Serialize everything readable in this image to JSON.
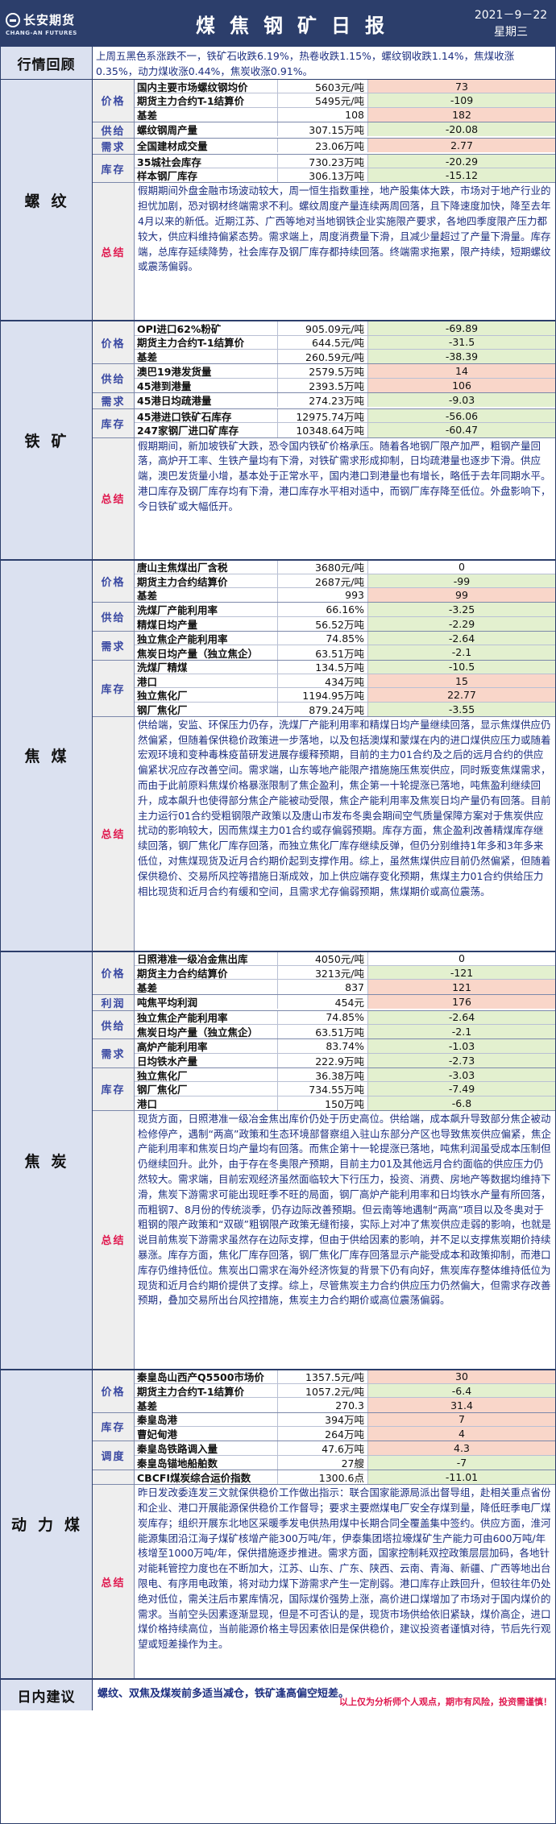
{
  "header": {
    "logo_cn": "长安期货",
    "logo_en": "CHANG-AN FUTURES",
    "title": "煤焦钢矿日报",
    "date": "2021－9－22",
    "weekday": "星期三"
  },
  "review": {
    "label": "行情回顾",
    "text": "上周五黑色系涨跌不一，铁矿石收跌6.19%，热卷收跌1.15%，螺纹钢收跌1.14%，焦煤收涨0.35%，动力煤收涨0.44%，焦炭收涨0.91%。"
  },
  "sections": [
    {
      "name": "螺纹",
      "groups": [
        {
          "label": "价格",
          "rows": [
            [
              "国内主要市场螺纹钢均价",
              "5603元/吨",
              "73",
              "up"
            ],
            [
              "期货主力合约T-1结算价",
              "5495元/吨",
              "-109",
              "dn"
            ],
            [
              "基差",
              "108",
              "182",
              "up"
            ]
          ]
        },
        {
          "label": "供给",
          "rows": [
            [
              "螺纹钢周产量",
              "307.15万吨",
              "-20.08",
              "dn"
            ]
          ]
        },
        {
          "label": "需求",
          "rows": [
            [
              "全国建材成交量",
              "23.06万吨",
              "2.77",
              "up"
            ]
          ]
        },
        {
          "label": "库存",
          "rows": [
            [
              "35城社会库存",
              "730.23万吨",
              "-20.29",
              "dn"
            ],
            [
              "样本钢厂库存",
              "306.13万吨",
              "-15.12",
              "dn"
            ]
          ]
        }
      ],
      "summary": "假期期间外盘金融市场波动较大，周一恒生指数重挫，地产股集体大跌，市场对于地产行业的担忧加剧，恐对钢材终端需求不利。螺纹周度产量连续两周回落，且下降速度加快，降至去年4月以来的新低。近期江苏、广西等地对当地钢铁企业实施限产要求，各地四季度限产压力都较大，供应料维持偏紧态势。需求端上，周度消费量下滑，且减少量超过了产量下滑量。库存端，总库存延续降势，社会库存及钢厂库存都持续回落。终端需求拖累，限产持续，短期螺纹或震荡偏弱。"
    },
    {
      "name": "铁矿",
      "groups": [
        {
          "label": "价格",
          "rows": [
            [
              "OPI进口62%粉矿",
              "905.09元/吨",
              "-69.89",
              "dn"
            ],
            [
              "期货主力合约T-1结算价",
              "644.5元/吨",
              "-31.5",
              "dn"
            ],
            [
              "基差",
              "260.59元/吨",
              "-38.39",
              "dn"
            ]
          ]
        },
        {
          "label": "供给",
          "rows": [
            [
              "澳巴19港发货量",
              "2579.5万吨",
              "14",
              "up"
            ],
            [
              "45港到港量",
              "2393.5万吨",
              "106",
              "up"
            ]
          ]
        },
        {
          "label": "需求",
          "rows": [
            [
              "45港日均疏港量",
              "274.23万吨",
              "-9.03",
              "dn"
            ]
          ]
        },
        {
          "label": "库存",
          "rows": [
            [
              "45港进口铁矿石库存",
              "12975.74万吨",
              "-56.06",
              "dn"
            ],
            [
              "247家钢厂进口矿库存",
              "10348.64万吨",
              "-60.47",
              "dn"
            ]
          ]
        }
      ],
      "summary": "假期期间，新加坡铁矿大跌，恐令国内铁矿价格承压。随着各地钢厂限产加严，粗钢产量回落，高炉开工率、生铁产量均有下滑，对铁矿需求形成抑制，日均疏港量也逐步下滑。供应端，澳巴发货量小增，基本处于正常水平，国内港口到港量也有增长，略低于去年同期水平。港口库存及钢厂库存均有下滑，港口库存水平相对适中，而钢厂库存降至低位。外盘影响下，今日铁矿或大幅低开。"
    },
    {
      "name": "焦煤",
      "groups": [
        {
          "label": "价格",
          "rows": [
            [
              "唐山主焦煤出厂含税",
              "3680元/吨",
              "0",
              "zero"
            ],
            [
              "期货主力合约结算价",
              "2687元/吨",
              "-99",
              "dn"
            ],
            [
              "基差",
              "993",
              "99",
              "up"
            ]
          ]
        },
        {
          "label": "供给",
          "rows": [
            [
              "洗煤厂产能利用率",
              "66.16%",
              "-3.25",
              "dn"
            ],
            [
              "精煤日均产量",
              "56.52万吨",
              "-2.29",
              "dn"
            ]
          ]
        },
        {
          "label": "需求",
          "rows": [
            [
              "独立焦企产能利用率",
              "74.85%",
              "-2.64",
              "dn"
            ],
            [
              "焦炭日均产量（独立焦企）",
              "63.51万吨",
              "-2.1",
              "dn"
            ]
          ]
        },
        {
          "label": "库存",
          "rows": [
            [
              "洗煤厂精煤",
              "134.5万吨",
              "-10.5",
              "dn"
            ],
            [
              "港口",
              "434万吨",
              "15",
              "up"
            ],
            [
              "独立焦化厂",
              "1194.95万吨",
              "22.77",
              "up"
            ],
            [
              "钢厂焦化厂",
              "879.24万吨",
              "-3.55",
              "dn"
            ]
          ]
        }
      ],
      "summary": "供给端，安监、环保压力仍存，洗煤厂产能利用率和精煤日均产量继续回落，显示焦煤供应仍然偏紧，但随着保供稳价政策进一步落地，以及包括澳煤和蒙煤在内的进口煤供应压力或随着宏观环境和变种毒株疫苗研发进展存缓释预期，目前的主力01合约及之后的远月合约的供应偏紧状况应存改善空间。需求端，山东等地产能限产措施施压焦炭供应，同时叛变焦煤需求，而由于此前原料焦煤价格暴涨限制了焦企盈利，焦企第一十轮提涨已落地，吨焦盈利继续回升，成本飙升也使得部分焦企产能被动受限，焦企产能利用率及焦炭日均产量仍有回落。目前主力运行01合约受粗钢限产政策以及唐山市发布冬奥会期间空气质量保障方案对于焦炭供应扰动的影响较大，因而焦煤主力01合约或存偏弱预期。库存方面，焦企盈利改善精煤库存继续回落，钢厂焦化厂库存回落，而独立焦化厂库存继续反弹，但仍分别维持1年多和3年多来低位，对焦煤现货及近月合约期价起到支撑作用。综上，虽然焦煤供应目前仍然偏紧，但随着保供稳价、交易所风控等措施日渐成效，加上供应端存变化预期，焦煤主力01合约供给压力相比现货和近月合约有缓和空间，且需求尤存偏弱预期，焦煤期价或高位震荡。"
    },
    {
      "name": "焦炭",
      "groups": [
        {
          "label": "价格",
          "rows": [
            [
              "日照港准一级冶金焦出库",
              "4050元/吨",
              "0",
              "zero"
            ],
            [
              "期货主力合约结算价",
              "3213元/吨",
              "-121",
              "dn"
            ],
            [
              "基差",
              "837",
              "121",
              "up"
            ]
          ]
        },
        {
          "label": "利润",
          "rows": [
            [
              "吨焦平均利润",
              "454元",
              "176",
              "up"
            ]
          ]
        },
        {
          "label": "供给",
          "rows": [
            [
              "独立焦企产能利用率",
              "74.85%",
              "-2.64",
              "dn"
            ],
            [
              "焦炭日均产量（独立焦企）",
              "63.51万吨",
              "-2.1",
              "dn"
            ]
          ]
        },
        {
          "label": "需求",
          "rows": [
            [
              "高炉产能利用率",
              "83.74%",
              "-1.03",
              "dn"
            ],
            [
              "日均铁水产量",
              "222.9万吨",
              "-2.73",
              "dn"
            ]
          ]
        },
        {
          "label": "库存",
          "rows": [
            [
              "独立焦化厂",
              "36.38万吨",
              "-3.03",
              "dn"
            ],
            [
              "钢厂焦化厂",
              "734.55万吨",
              "-7.49",
              "dn"
            ],
            [
              "港口",
              "150万吨",
              "-6.8",
              "dn"
            ]
          ]
        }
      ],
      "summary": "现货方面，日照港准一级冶金焦出库价仍处于历史高位。供给端，成本飙升导致部分焦企被动检修停产，遇制“两高”政策和生态环境部督察组入驻山东部分产区也导致焦炭供应偏紧，焦企产能利用率和焦炭日均产量均有回落。而焦企第十一轮提涨已落地，吨焦利润虽受成本压制但仍继续回升。此外，由于存在冬奥限产预期，目前主力01及其他远月合约面临的供应压力仍然较大。需求端，目前宏观经济虽然面临较大下行压力，投资、消费、房地产等数据均维持下滑，焦炭下游需求可能出现旺季不旺的局面，钢厂高炉产能利用率和日均铁水产量有所回落，而粗钢7、8月份的传统淡季，仍存边际改善预期。但云南等地遇制“两高”项目以及冬奥对于粗钢的限产政策和“双碳”粗钢限产政策无缝衔接，实际上对冲了焦炭供应走弱的影响，也就是说目前焦炭下游需求虽然存在边际支撑，但由于供给因素的影响，并不足以支撑焦炭期价持续暴涨。库存方面，焦化厂库存回落，钢厂焦化厂库存回落显示产能受成本和政策抑制，而港口库存仍维持低位。焦炭出口需求在海外经济恢复的背景下仍有向好，焦炭库存整体维持低位为现货和近月合约期价提供了支撑。综上，尽管焦炭主力合约供应压力仍然偏大，但需求存改善预期，叠加交易所出台风控措施，焦炭主力合约期价或高位震荡偏弱。"
    },
    {
      "name": "动力煤",
      "groups": [
        {
          "label": "价格",
          "rows": [
            [
              "秦皇岛山西产Q5500市场价",
              "1357.5元/吨",
              "30",
              "up"
            ],
            [
              "期货主力合约T-1结算价",
              "1057.2元/吨",
              "-6.4",
              "dn"
            ],
            [
              "基差",
              "270.3",
              "31.4",
              "up"
            ]
          ]
        },
        {
          "label": "库存",
          "rows": [
            [
              "秦皇岛港",
              "394万吨",
              "7",
              "up"
            ],
            [
              "曹妃甸港",
              "264万吨",
              "4",
              "up"
            ]
          ]
        },
        {
          "label": "调度",
          "rows": [
            [
              "秦皇岛铁路调入量",
              "47.6万吨",
              "4.3",
              "up"
            ],
            [
              "秦皇岛锚地船舶数",
              "27艘",
              "-7",
              "dn"
            ]
          ]
        },
        {
          "label": "",
          "rows": [
            [
              "CBCFI煤炭综合运价指数",
              "1300.6点",
              "-11.01",
              "dn"
            ]
          ]
        }
      ],
      "summary": "昨日发改委连发三文就保供稳价工作做出指示：联合国家能源局派出督导组，赴相关重点省份和企业、港口开展能源保供稳价工作督导；要求主要燃煤电厂安全存煤到量，降低旺季电厂煤炭库存；组织开展东北地区采暖季发电供热用煤中长期合同全覆盖集中签约。供应方面，淮河能源集团沿江海子煤矿核增产能300万吨/年，伊泰集团塔拉壕煤矿生产能力可由600万吨/年核增至1000万吨/年，保供措施逐步推进。需求方面，国家控制耗双控政策层层加码，各地针对能耗管控力度也在不断加大，江苏、山东、广东、陕西、云南、青海、新疆、广西等地出台限电、有序用电政策，将对动力煤下游需求产生一定削弱。港口库存止跌回升，但较往年仍处绝对低位，需关注后市累库情况，国际煤价强势上涨，高价进口煤增加了市场对于国内煤价的需求。当前空头因素逐渐显现，但是不可否认的是，现货市场供给依旧紧缺，煤价高企，进口煤价格持续高位，当前能源价格主导因素依旧是保供稳价，建议投资者谨慎对待，节后先行观望或短差操作为主。"
    }
  ],
  "footer": {
    "label": "日内建议",
    "text": "螺纹、双焦及煤炭前多适当减仓，铁矿逢高偏空短差。",
    "disclaimer": "以上仅为分析师个人观点，期市有风险，投资需谨慎！"
  },
  "colors": {
    "header": "#2c3e6b",
    "label_bg": "#dbe1f0",
    "positive": "#f9d6c9",
    "negative": "#e3f0cf",
    "summary_label": "#e0184e"
  },
  "icons": {
    "logo": "chang-an-logo-icon"
  }
}
